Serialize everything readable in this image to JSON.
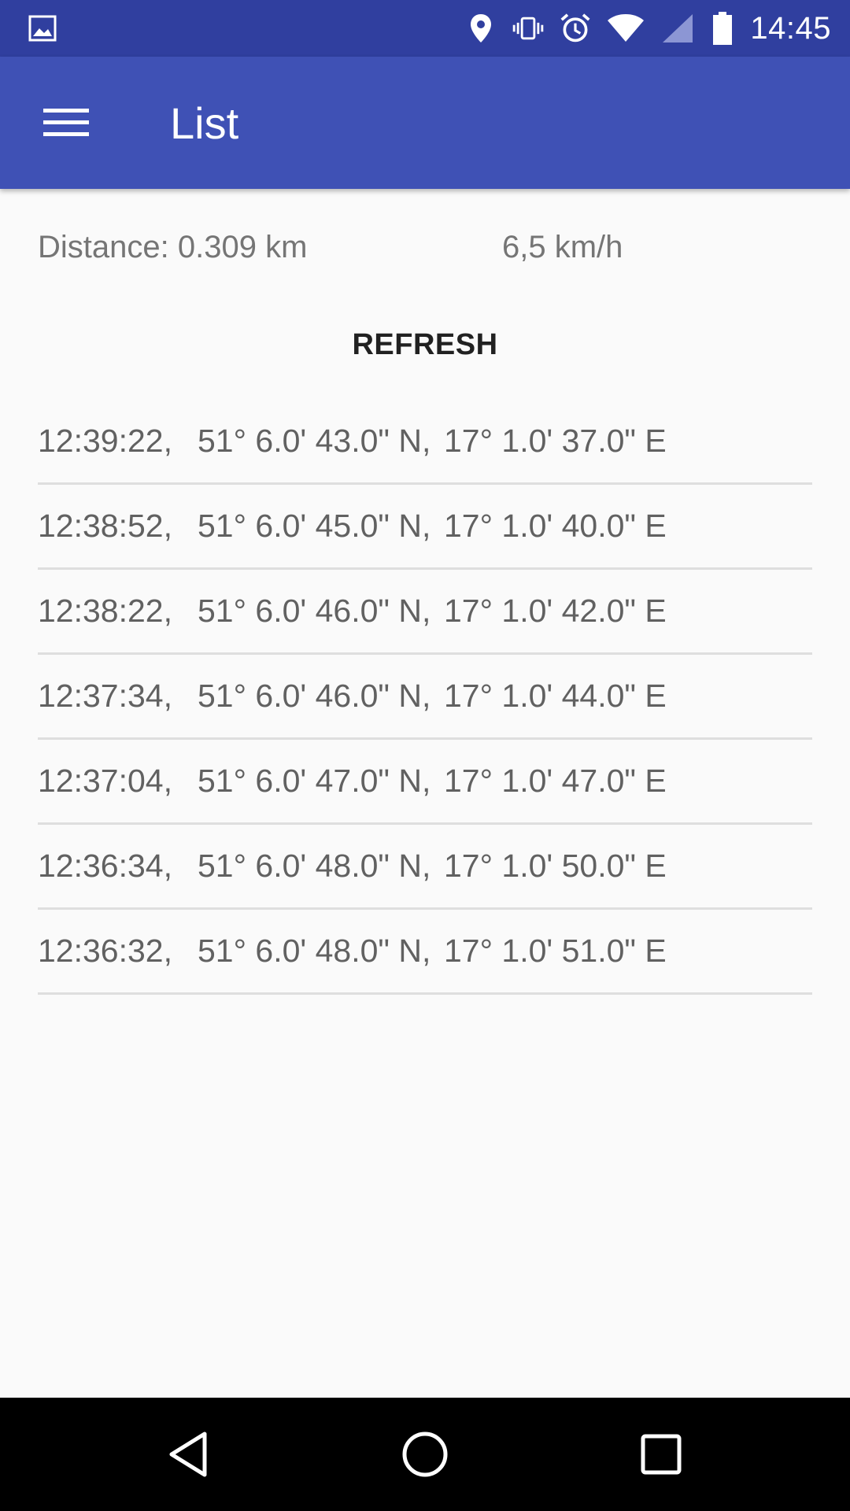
{
  "status_bar": {
    "time": "14:45",
    "icons": [
      "image-notification-icon",
      "location-icon",
      "vibrate-icon",
      "alarm-icon",
      "wifi-icon",
      "cell-signal-icon",
      "battery-icon"
    ]
  },
  "app_bar": {
    "title": "List",
    "menu_icon": "hamburger-menu-icon",
    "background": "#3f51b5"
  },
  "stats": {
    "distance": "Distance: 0.309 km",
    "speed": "6,5 km/h"
  },
  "refresh_label": "REFRESH",
  "entries": [
    {
      "time": "12:39:22,",
      "lat": "51° 6.0' 43.0\" N,",
      "lon": "17° 1.0' 37.0\" E"
    },
    {
      "time": "12:38:52,",
      "lat": "51° 6.0' 45.0\" N,",
      "lon": "17° 1.0' 40.0\" E"
    },
    {
      "time": "12:38:22,",
      "lat": "51° 6.0' 46.0\" N,",
      "lon": "17° 1.0' 42.0\" E"
    },
    {
      "time": "12:37:34,",
      "lat": "51° 6.0' 46.0\" N,",
      "lon": "17° 1.0' 44.0\" E"
    },
    {
      "time": "12:37:04,",
      "lat": "51° 6.0' 47.0\" N,",
      "lon": "17° 1.0' 47.0\" E"
    },
    {
      "time": "12:36:34,",
      "lat": "51° 6.0' 48.0\" N,",
      "lon": "17° 1.0' 50.0\" E"
    },
    {
      "time": "12:36:32,",
      "lat": "51° 6.0' 48.0\" N,",
      "lon": "17° 1.0' 51.0\" E"
    }
  ],
  "nav_bar": {
    "icons": [
      "back-icon",
      "home-icon",
      "recents-icon"
    ]
  }
}
